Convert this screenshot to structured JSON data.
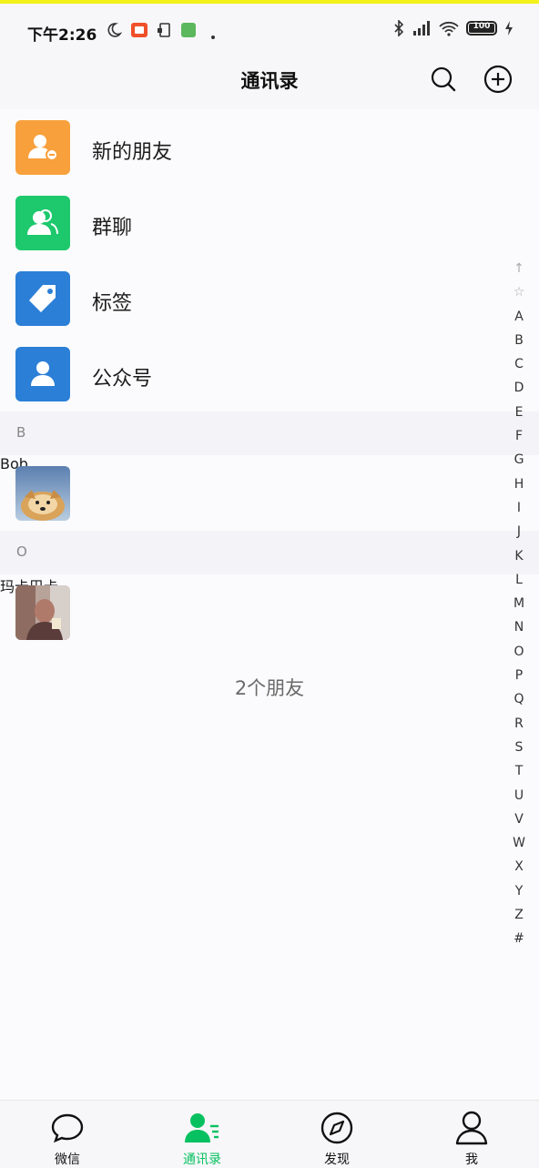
{
  "status_bar": {
    "time": "下午2:26",
    "battery": "100",
    "battery_level": 1.0
  },
  "header": {
    "title": "通讯录"
  },
  "function_items": [
    {
      "label": "新的朋友",
      "icon": "new-friend-icon",
      "color": "#f8a03c"
    },
    {
      "label": "群聊",
      "icon": "group-chat-icon",
      "color": "#1ec86d"
    },
    {
      "label": "标签",
      "icon": "tag-icon",
      "color": "#2b7fd6"
    },
    {
      "label": "公众号",
      "icon": "official-account-icon",
      "color": "#2b7fd6"
    }
  ],
  "sections": [
    {
      "letter": "B",
      "contacts": [
        {
          "name": "Bob."
        }
      ]
    },
    {
      "letter": "O",
      "contacts": [
        {
          "name": "玛卡巴卡"
        }
      ]
    }
  ],
  "friend_count": "2个朋友",
  "index_letters": [
    "↑",
    "☆",
    "A",
    "B",
    "C",
    "D",
    "E",
    "F",
    "G",
    "H",
    "I",
    "J",
    "K",
    "L",
    "M",
    "N",
    "O",
    "P",
    "Q",
    "R",
    "S",
    "T",
    "U",
    "V",
    "W",
    "X",
    "Y",
    "Z",
    "#"
  ],
  "tabs": [
    {
      "label": "微信",
      "icon": "chat-bubble-icon",
      "active": false
    },
    {
      "label": "通讯录",
      "icon": "contacts-icon",
      "active": true
    },
    {
      "label": "发现",
      "icon": "compass-icon",
      "active": false
    },
    {
      "label": "我",
      "icon": "person-icon",
      "active": false
    }
  ],
  "colors": {
    "accent": "#07c160"
  }
}
